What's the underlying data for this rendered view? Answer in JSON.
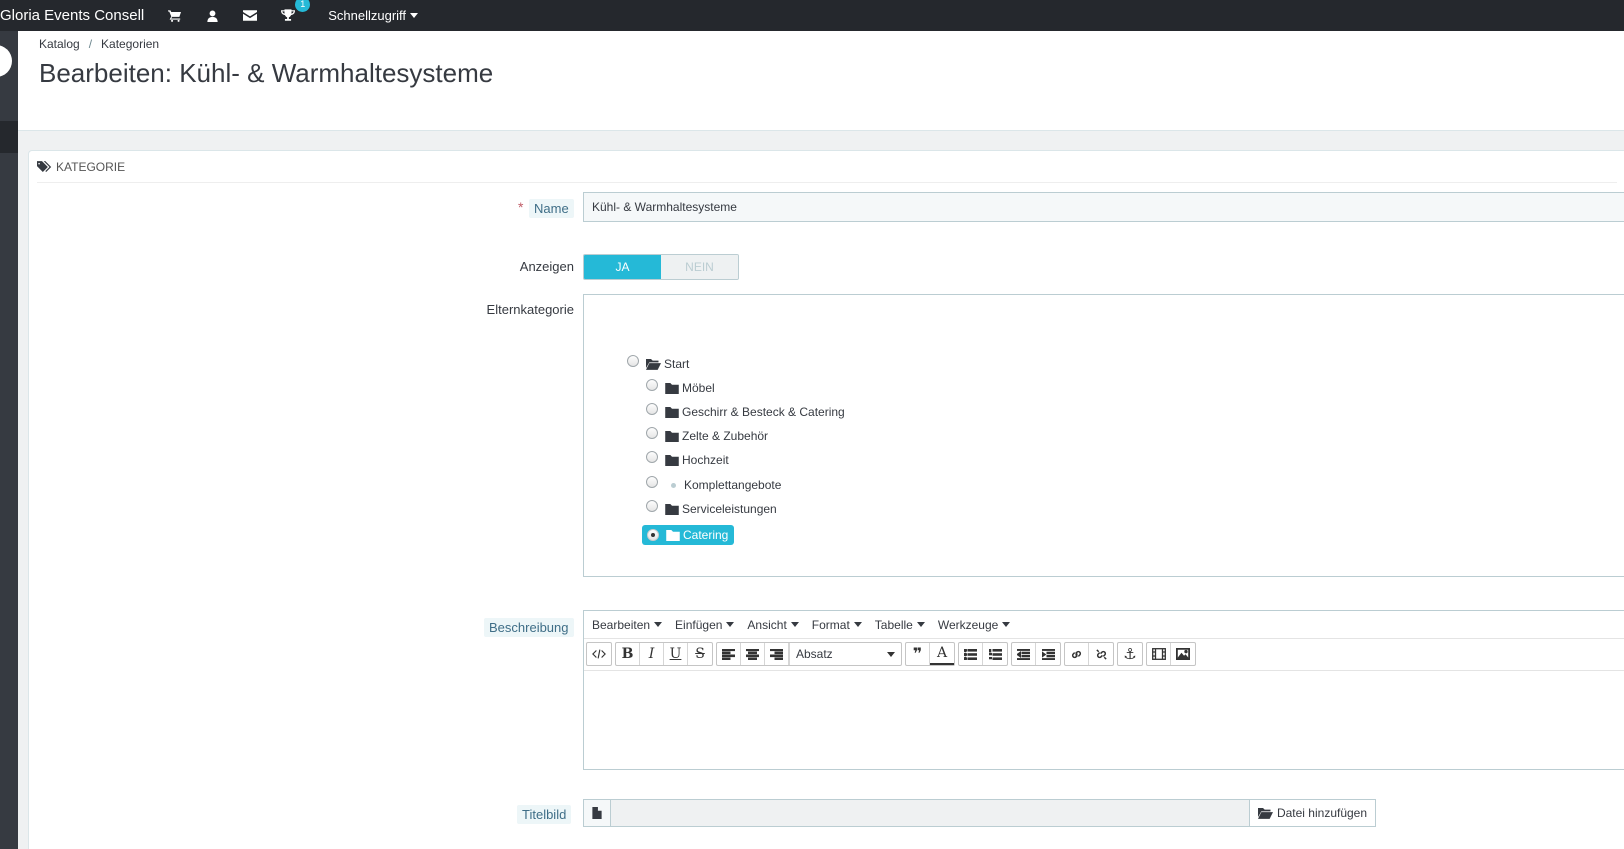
{
  "topbar": {
    "brand": "Gloria Events Consell",
    "icons": [
      "cart-icon",
      "user-icon",
      "envelope-icon",
      "trophy-icon"
    ],
    "trophy_badge": "1",
    "quick_access": "Schnellzugriff"
  },
  "breadcrumb": {
    "items": [
      "Katalog",
      "Kategorien"
    ],
    "separator": "/"
  },
  "page_title": "Bearbeiten: Kühl- & Warmhaltesysteme",
  "panel": {
    "heading": "KATEGORIE"
  },
  "form": {
    "name": {
      "required_mark": "*",
      "label": "Name",
      "value": "Kühl- & Warmhaltesysteme"
    },
    "display": {
      "label": "Anzeigen",
      "yes": "JA",
      "no": "NEIN",
      "selected": "JA"
    },
    "parent": {
      "label": "Elternkategorie",
      "tree": [
        {
          "label": "Start",
          "icon": "folder-open-icon",
          "checked": false
        },
        {
          "label": "Möbel",
          "icon": "folder-icon",
          "checked": false
        },
        {
          "label": "Geschirr & Besteck & Catering",
          "icon": "folder-icon",
          "checked": false
        },
        {
          "label": "Zelte & Zubehör",
          "icon": "folder-icon",
          "checked": false
        },
        {
          "label": "Hochzeit",
          "icon": "folder-icon",
          "checked": false
        },
        {
          "label": "Komplettangebote",
          "icon": "leaf-dot",
          "checked": false
        },
        {
          "label": "Serviceleistungen",
          "icon": "folder-icon",
          "checked": false
        },
        {
          "label": "Catering",
          "icon": "folder-icon",
          "checked": true
        }
      ]
    },
    "description": {
      "label": "Beschreibung",
      "menus": [
        "Bearbeiten",
        "Einfügen",
        "Ansicht",
        "Format",
        "Tabelle",
        "Werkzeuge"
      ],
      "block_format": "Absatz"
    },
    "cover_image": {
      "label": "Titelbild",
      "button": "Datei hinzufügen"
    }
  },
  "colors": {
    "accent": "#25b9d7",
    "topbar": "#25282d",
    "sidebar": "#363a41"
  }
}
